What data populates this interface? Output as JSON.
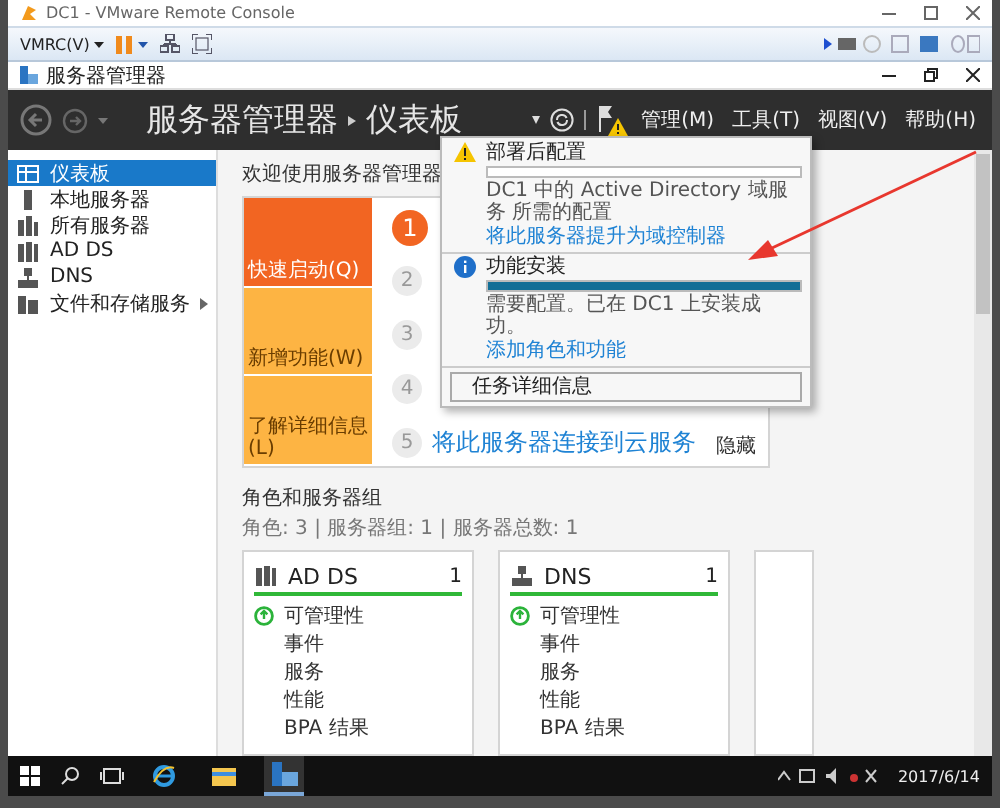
{
  "vmrc": {
    "title": "DC1 - VMware Remote Console",
    "menu": "VMRC(V)"
  },
  "window": {
    "title": "服务器管理器"
  },
  "header": {
    "breadcrumb": [
      "服务器管理器",
      "仪表板"
    ],
    "menus": [
      "管理(M)",
      "工具(T)",
      "视图(V)",
      "帮助(H)"
    ],
    "warning": true
  },
  "sidebar": {
    "items": [
      {
        "label": "仪表板",
        "selected": true,
        "expandable": false
      },
      {
        "label": "本地服务器",
        "selected": false,
        "expandable": false
      },
      {
        "label": "所有服务器",
        "selected": false,
        "expandable": false
      },
      {
        "label": "AD DS",
        "selected": false,
        "expandable": false
      },
      {
        "label": "DNS",
        "selected": false,
        "expandable": false
      },
      {
        "label": "文件和存储服务",
        "selected": false,
        "expandable": true
      }
    ]
  },
  "welcome": {
    "title": "欢迎使用服务器管理器",
    "tiles": [
      {
        "label": "快速启动(Q)",
        "selected": true
      },
      {
        "label": "新增功能(W)",
        "selected": false
      },
      {
        "label": "了解详细信息(L)",
        "selected": false
      }
    ],
    "steps": [
      {
        "number": "1",
        "selected": true
      },
      {
        "number": "2",
        "selected": false
      },
      {
        "number": "3",
        "selected": false
      },
      {
        "number": "4",
        "selected": false
      },
      {
        "number": "5",
        "selected": false,
        "text": "将此服务器连接到云服务"
      }
    ],
    "hide": "隐藏"
  },
  "roles": {
    "title": "角色和服务器组",
    "summary": "角色: 3 | 服务器组: 1 | 服务器总数: 1",
    "cards": [
      {
        "name": "AD DS",
        "count": "1",
        "rows": [
          {
            "label": "可管理性",
            "ok": true
          },
          {
            "label": "事件",
            "ok": false
          },
          {
            "label": "服务",
            "ok": false
          },
          {
            "label": "性能",
            "ok": false
          },
          {
            "label": "BPA 结果",
            "ok": false
          }
        ]
      },
      {
        "name": "DNS",
        "count": "1",
        "rows": [
          {
            "label": "可管理性",
            "ok": true
          },
          {
            "label": "事件",
            "ok": false
          },
          {
            "label": "服务",
            "ok": false
          },
          {
            "label": "性能",
            "ok": false
          },
          {
            "label": "BPA 结果",
            "ok": false
          }
        ]
      }
    ]
  },
  "notifications": {
    "items": [
      {
        "kind": "warning",
        "title": "部署后配置",
        "level": 0,
        "text": "DC1 中的 Active Directory 域服务 所需的配置",
        "link": "将此服务器提升为域控制器"
      },
      {
        "kind": "info",
        "title": "功能安装",
        "level": 1,
        "text": "需要配置。已在 DC1 上安装成功。",
        "link": "添加角色和功能"
      }
    ],
    "button": "任务详细信息"
  },
  "taskbar": {
    "apps": [
      {
        "selected": false
      },
      {
        "selected": false
      },
      {
        "selected": true
      }
    ],
    "date": "2017/6/14"
  }
}
